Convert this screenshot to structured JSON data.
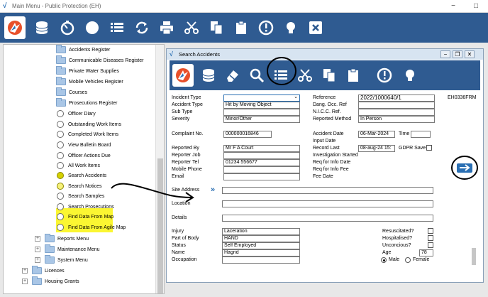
{
  "window": {
    "title": "Main Menu - Public Protection (EH)",
    "min": "−",
    "max": "□"
  },
  "toolbar": [
    "app-logo-icon",
    "database-icon",
    "stopwatch-icon",
    "circle-icon",
    "list-icon",
    "refresh-icon",
    "print-icon",
    "scissors-icon",
    "copy-icon",
    "clipboard-icon",
    "alert-icon",
    "lightbulb-icon",
    "close-icon"
  ],
  "tree": {
    "folders_top": [
      "Accidents Register",
      "Communicable Diseases Register",
      "Private Water Supplies",
      "Mobile Vehicles Register",
      "Courses",
      "Prosecutions Register"
    ],
    "items": [
      "Officer Diary",
      "Outstanding Work Items",
      "Completed Work Items",
      "View Bulletin Board",
      "Officer Actions Due",
      "All Work Items",
      "Search Accidents",
      "Search Notices",
      "Search Samples",
      "Search Prosecutions",
      "Find Data From Map",
      "Find Data From Agile Map"
    ],
    "menus": [
      "Reports Menu",
      "Maintenance Menu",
      "System Menu"
    ],
    "roots": [
      "Licences",
      "Housing Grants"
    ],
    "expand": "+"
  },
  "dialog": {
    "title": "Search Accidents",
    "frm_code": "EH0336FRM",
    "buttons": {
      "min": "−",
      "restore": "❐",
      "close": "✕"
    },
    "toolbar": [
      "app-logo-icon",
      "database-icon",
      "eraser-icon",
      "search-icon",
      "list-icon",
      "scissors-icon",
      "copy-icon",
      "clipboard-icon",
      "alert-icon",
      "lightbulb-icon"
    ],
    "left_fields": [
      {
        "label": "Incident Type",
        "value": ""
      },
      {
        "label": "Accident Type",
        "value": "Hit by Moving Object"
      },
      {
        "label": "Sub Type",
        "value": ""
      },
      {
        "label": "Severity",
        "value": "Minor/Other"
      }
    ],
    "complaint_no": {
      "label": "Complaint No.",
      "value": "000000016846"
    },
    "reporter_fields": [
      {
        "label": "Reported By",
        "value": "Mr F A Court"
      },
      {
        "label": "Reporter Job",
        "value": ""
      },
      {
        "label": "Reporter Tel",
        "value": "01234 556677"
      },
      {
        "label": "Mobile Phone",
        "value": ""
      },
      {
        "label": "Email",
        "value": ""
      }
    ],
    "right_fields": [
      {
        "label": "Reference",
        "value": "2022/1000640/1"
      },
      {
        "label": "Dang. Occ. Ref",
        "value": ""
      },
      {
        "label": "N.I.C.C. Ref.",
        "value": ""
      },
      {
        "label": "Reported Method",
        "value": "In Person"
      }
    ],
    "accident_date": {
      "label": "Accident Date",
      "value": "06-Mar-2024"
    },
    "time": {
      "label": "Time",
      "value": ""
    },
    "date_labels": [
      "Input Date",
      "Record Last",
      "Investigation Started",
      "Req for Info Date",
      "Req for Info Fee",
      "Fee Date"
    ],
    "record_last": "08-aug-24 15:",
    "gdpr": "GDPR Save",
    "site_address": {
      "label": "Site Address",
      "chevron": "»",
      "value": ""
    },
    "location": {
      "label": "Location",
      "value": ""
    },
    "details": {
      "label": "Details",
      "value": ""
    },
    "injury_fields": [
      {
        "label": "Injury",
        "value": "Laceration"
      },
      {
        "label": "Part of Body",
        "value": "HAND"
      },
      {
        "label": "Status",
        "value": "Self Employed"
      },
      {
        "label": "Name",
        "value": "Hagrid"
      },
      {
        "label": "Occupation",
        "value": ""
      }
    ],
    "checks": [
      "Resuscitated?",
      "Hospitalised?",
      "Unconcious?"
    ],
    "age": {
      "label": "Age",
      "value": "78"
    },
    "gender": {
      "male": "Male",
      "female": "Female",
      "selected": "Male"
    },
    "dropdown_arrow": "⌄"
  },
  "colors": {
    "toolbar": "#2f5b91",
    "highlight": "#fbf632",
    "arrow_blue": "#2a6fb3"
  }
}
